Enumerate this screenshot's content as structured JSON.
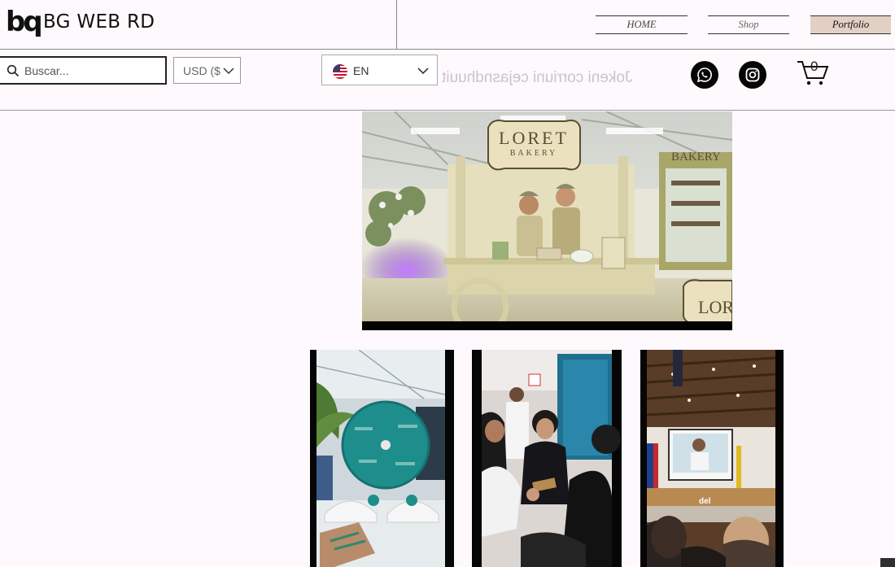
{
  "header": {
    "logo_mark": "bq",
    "brand": "BG WEB RD",
    "nav": [
      {
        "label": "HOME"
      },
      {
        "label": "Shop"
      },
      {
        "label": "Portfolio"
      }
    ]
  },
  "toolbar": {
    "search_placeholder": "Buscar...",
    "currency": "USD ($",
    "language": "EN",
    "ghost_text": "Jokeni corriuni cejasndhuuit",
    "cart_count": "0"
  },
  "media": {
    "hero": {
      "sign_title": "LORET",
      "sign_subtitle": "BAKERY",
      "side_sign": "BAKERY",
      "corner_sign": "LOR"
    },
    "tiles": [
      {
        "caption": ""
      },
      {
        "caption": ""
      },
      {
        "caption": "del"
      }
    ]
  },
  "colors": {
    "page_bg": "#fdf9fc",
    "nav_active_bg": "#e3d0c4",
    "social_bg": "#050505"
  },
  "icons": [
    "search-icon",
    "chevron-down-icon",
    "us-flag-icon",
    "whatsapp-icon",
    "instagram-icon",
    "cart-icon"
  ]
}
